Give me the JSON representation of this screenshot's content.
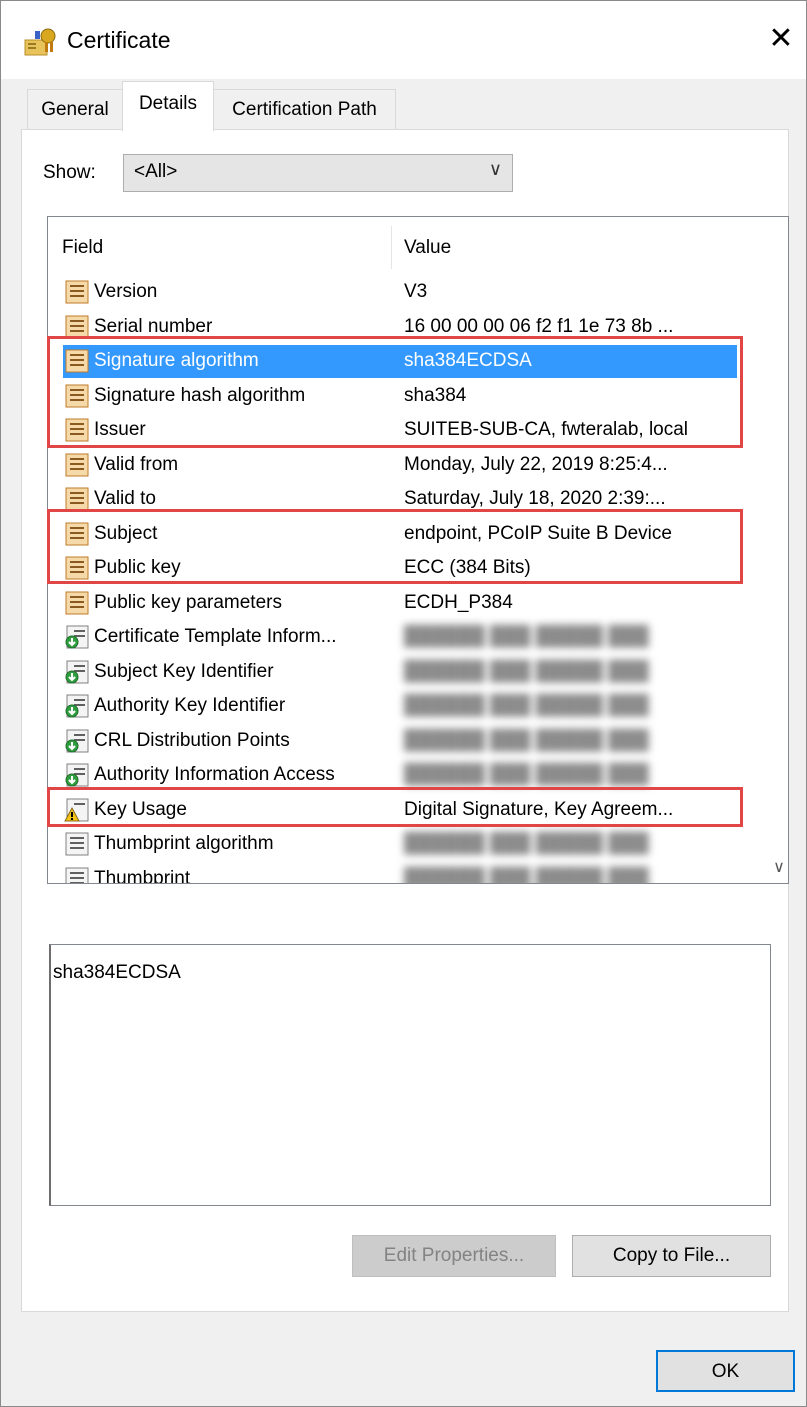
{
  "window": {
    "title": "Certificate",
    "close_glyph": "✕"
  },
  "tabs": [
    {
      "label": "General",
      "active": false
    },
    {
      "label": "Details",
      "active": true
    },
    {
      "label": "Certification Path",
      "active": false
    }
  ],
  "show": {
    "label": "Show:",
    "selected": "<All>"
  },
  "list": {
    "headers": {
      "field": "Field",
      "value": "Value"
    },
    "rows": [
      {
        "field": "Version",
        "value": "V3",
        "icon": "certificate-field-icon",
        "blurred": false,
        "selected": false
      },
      {
        "field": "Serial number",
        "value": "16 00 00 00 06 f2 f1 1e 73 8b ...",
        "icon": "certificate-field-icon",
        "blurred": false,
        "selected": false
      },
      {
        "field": "Signature algorithm",
        "value": "sha384ECDSA",
        "icon": "certificate-field-icon",
        "blurred": false,
        "selected": true
      },
      {
        "field": "Signature hash algorithm",
        "value": "sha384",
        "icon": "certificate-field-icon",
        "blurred": false,
        "selected": false
      },
      {
        "field": "Issuer",
        "value": "SUITEB-SUB-CA, fwteralab, local",
        "icon": "certificate-field-icon",
        "blurred": false,
        "selected": false
      },
      {
        "field": "Valid from",
        "value": "Monday, July 22, 2019 8:25:4...",
        "icon": "certificate-field-icon",
        "blurred": false,
        "selected": false
      },
      {
        "field": "Valid to",
        "value": "Saturday, July 18, 2020 2:39:...",
        "icon": "certificate-field-icon",
        "blurred": false,
        "selected": false
      },
      {
        "field": "Subject",
        "value": "endpoint, PCoIP Suite B Device",
        "icon": "certificate-field-icon",
        "blurred": false,
        "selected": false
      },
      {
        "field": "Public key",
        "value": "ECC (384 Bits)",
        "icon": "certificate-field-icon",
        "blurred": false,
        "selected": false
      },
      {
        "field": "Public key parameters",
        "value": "ECDH_P384",
        "icon": "certificate-field-icon",
        "blurred": false,
        "selected": false
      },
      {
        "field": "Certificate Template Inform...",
        "value": "",
        "icon": "certificate-extension-icon",
        "blurred": true,
        "selected": false
      },
      {
        "field": "Subject Key Identifier",
        "value": "",
        "icon": "certificate-extension-icon",
        "blurred": true,
        "selected": false
      },
      {
        "field": "Authority Key Identifier",
        "value": "",
        "icon": "certificate-extension-icon",
        "blurred": true,
        "selected": false
      },
      {
        "field": "CRL Distribution Points",
        "value": "",
        "icon": "certificate-extension-icon",
        "blurred": true,
        "selected": false
      },
      {
        "field": "Authority Information Access",
        "value": "",
        "icon": "certificate-extension-icon",
        "blurred": true,
        "selected": false
      },
      {
        "field": "Key Usage",
        "value": "Digital Signature, Key Agreem...",
        "icon": "warning-field-icon",
        "blurred": false,
        "selected": false
      },
      {
        "field": "Thumbprint algorithm",
        "value": "",
        "icon": "property-field-icon",
        "blurred": true,
        "selected": false
      },
      {
        "field": "Thumbprint",
        "value": "",
        "icon": "property-field-icon",
        "blurred": true,
        "selected": false
      }
    ]
  },
  "detail": {
    "text": "sha384ECDSA"
  },
  "buttons": {
    "edit_properties": "Edit Properties...",
    "copy_to_file": "Copy to File...",
    "ok": "OK"
  },
  "colors": {
    "selection": "#3399ff",
    "annotation_box": "#e14646",
    "default_button_border": "#0078d7"
  }
}
